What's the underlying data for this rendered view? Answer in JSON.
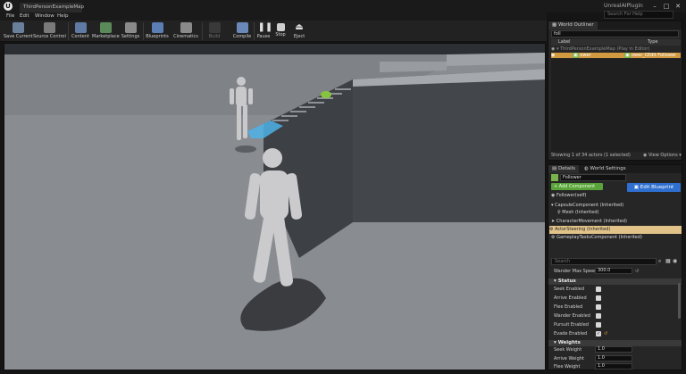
{
  "window": {
    "level_tab": "ThirdPersonExampleMap",
    "title": "UnrealAIPlugin",
    "help_search_placeholder": "Search For Help"
  },
  "menu": [
    "File",
    "Edit",
    "Window",
    "Help"
  ],
  "toolbar": [
    {
      "label": "Save Current",
      "icon": "save-icon",
      "color": "#6a7f9a"
    },
    {
      "label": "Source Control",
      "icon": "source-control-icon",
      "color": "#7a7a7a"
    },
    {
      "label": "Content",
      "icon": "content-icon",
      "color": "#5f7aa3"
    },
    {
      "label": "Marketplace",
      "icon": "marketplace-icon",
      "color": "#5a8a5a"
    },
    {
      "label": "Settings",
      "icon": "settings-icon",
      "color": "#8a8a8a"
    },
    {
      "label": "Blueprints",
      "icon": "blueprints-icon",
      "color": "#5b7eb5"
    },
    {
      "label": "Cinematics",
      "icon": "cinematics-icon",
      "color": "#8a8a8a"
    },
    {
      "label": "Build",
      "icon": "build-icon",
      "color": "#555555"
    },
    {
      "label": "Compile",
      "icon": "compile-icon",
      "color": "#6a88b8"
    },
    {
      "label": "Pause",
      "icon": "pause-icon",
      "color": "#bdbdbd"
    },
    {
      "label": "Stop",
      "icon": "stop-icon",
      "color": "#bdbdbd"
    },
    {
      "label": "Eject",
      "icon": "eject-icon",
      "color": "#bdbdbd"
    }
  ],
  "outliner": {
    "tab_label": "World Outliner",
    "search_value": "foll",
    "col_label": "Label",
    "col_type": "Type",
    "root_label": "ThirdPersonExampleMap (Play In Editor)",
    "item_label": "ower",
    "item_type_prefix": "ower_C",
    "item_type_link": "Edit Follower",
    "status": "Showing 1 of 34 actors (1 selected)",
    "view_options": "View Options"
  },
  "details": {
    "tab_details": "Details",
    "tab_world": "World Settings",
    "name_value": "Follower",
    "add_component": "+ Add Component",
    "edit_blueprint": "Edit Blueprint",
    "self_label": "Follower(self)",
    "components": [
      "CapsuleComponent (Inherited)",
      "Mesh (Inherited)",
      "CharacterMovement (Inherited)",
      "ActorSteering (Inherited)",
      "GameplayTasksComponent (Inherited)"
    ],
    "search_placeholder": "Search",
    "wander_label": "Wander Max Speed",
    "wander_value": "300.0",
    "status_section": "Status",
    "status_items": [
      "Seek Enabled",
      "Arrive Enabled",
      "Flee Enabled",
      "Wander Enabled",
      "Pursuit Enabled",
      "Evade Enabled"
    ],
    "weights_section": "Weights",
    "weights": [
      {
        "label": "Seek Weight",
        "value": "1.0"
      },
      {
        "label": "Arrive Weight",
        "value": "1.0"
      },
      {
        "label": "Flee Weight",
        "value": "1.0"
      }
    ]
  }
}
